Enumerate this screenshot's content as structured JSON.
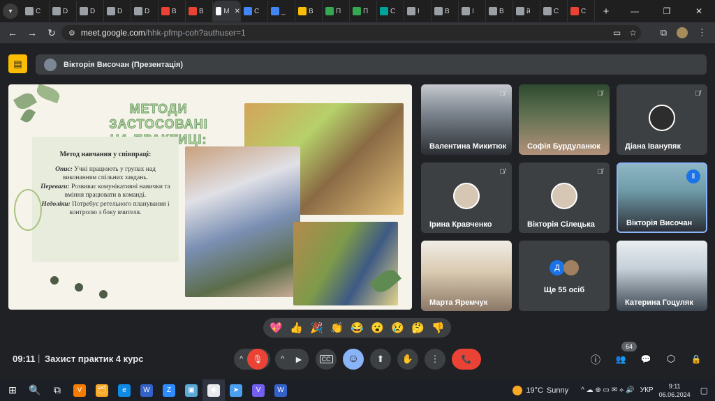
{
  "browser": {
    "tabs": [
      {
        "letter": "C",
        "color": "#9aa0a6"
      },
      {
        "letter": "D",
        "color": "#9aa0a6"
      },
      {
        "letter": "D",
        "color": "#9aa0a6"
      },
      {
        "letter": "D",
        "color": "#9aa0a6"
      },
      {
        "letter": "D",
        "color": "#9aa0a6"
      },
      {
        "letter": "B",
        "color": "#ea4335"
      },
      {
        "letter": "B",
        "color": "#ea4335"
      },
      {
        "letter": "M",
        "color": "#f8f9fa"
      },
      {
        "letter": "C",
        "color": "#4285f4"
      },
      {
        "letter": "_",
        "color": "#4285f4"
      },
      {
        "letter": "B",
        "color": "#fbbc04"
      },
      {
        "letter": "П",
        "color": "#34a853"
      },
      {
        "letter": "П",
        "color": "#34a853"
      },
      {
        "letter": "C",
        "color": "#00a39b"
      },
      {
        "letter": "I",
        "color": "#9aa0a6"
      },
      {
        "letter": "B",
        "color": "#9aa0a6"
      },
      {
        "letter": "I",
        "color": "#9aa0a6"
      },
      {
        "letter": "B",
        "color": "#9aa0a6"
      },
      {
        "letter": "й",
        "color": "#9aa0a6"
      },
      {
        "letter": "C",
        "color": "#9aa0a6"
      },
      {
        "letter": "C",
        "color": "#ea4335"
      }
    ],
    "active_tab_close": "✕",
    "new_tab": "+",
    "window_controls": {
      "minimize": "—",
      "restore": "❐",
      "close": "✕"
    },
    "url_host": "meet.google.com",
    "url_path": "/hhk-pfmp-coh?authuser=1"
  },
  "meet": {
    "presenter_banner": "Вікторія Височан (Презентація)",
    "slide": {
      "title_line1": "МЕТОДИ ЗАСТОСОВАНІ",
      "title_line2": "НА ПРАКТИЦІ:",
      "heading": "Метод навчання у співпраці:",
      "opys_label": "Опис:",
      "opys_text": "Учні працюють у групах над виконанням спільних завдань.",
      "perevahy_label": "Переваги:",
      "perevahy_text": "Розвиває комунікативні навички та вміння працювати в команді.",
      "nedoliky_label": "Недоліки:",
      "nedoliky_text": "Потребує ретельного планування і контролю з боку вчителя."
    },
    "participants": [
      {
        "name": "Валентина Микитюк",
        "video": true
      },
      {
        "name": "Софія Бурдуланюк",
        "video": true
      },
      {
        "name": "Діана Іванупяк",
        "video": false
      },
      {
        "name": "Ірина Кравченко",
        "video": false
      },
      {
        "name": "Вікторія Сілецька",
        "video": false
      },
      {
        "name": "Вікторія Височан",
        "video": true,
        "speaking": true
      },
      {
        "name": "Марта Яремчук",
        "video": true
      },
      {
        "name": "Ще 55 осіб",
        "video": false
      },
      {
        "name": "Катерина Гоцуляк",
        "video": true
      }
    ],
    "more_avatar_letter": "Д",
    "reactions": [
      "💖",
      "👍",
      "🎉",
      "👏",
      "😂",
      "😮",
      "😢",
      "🤔",
      "👎"
    ],
    "time": "09:11",
    "meeting_title": "Захист практик 4 курс",
    "people_count": "64",
    "controls": {
      "mic_toggle": "^",
      "mic": "🎤",
      "cam_toggle": "^",
      "cam": "📹",
      "cc": "CC",
      "emoji": "☺",
      "present": "⬆",
      "hand": "✋",
      "more": "⋮",
      "end": "📞"
    },
    "right_controls": {
      "info": "ⓘ",
      "people": "👥",
      "chat": "💬",
      "activities": "⬡",
      "host": "🔒"
    }
  },
  "taskbar": {
    "apps": [
      "⊞",
      "🔍",
      "⧉",
      "V",
      "🗂",
      "e",
      "W",
      "Z",
      "▣",
      "◉",
      "➤",
      "V",
      "W"
    ],
    "weather_temp": "19°C",
    "weather_desc": "Sunny",
    "lang": "УКР",
    "time": "9:11",
    "date": "06.06.2024",
    "tray_icons": "^ ☁ ⊕ ▭ ✉ ⟡ 🔊"
  }
}
